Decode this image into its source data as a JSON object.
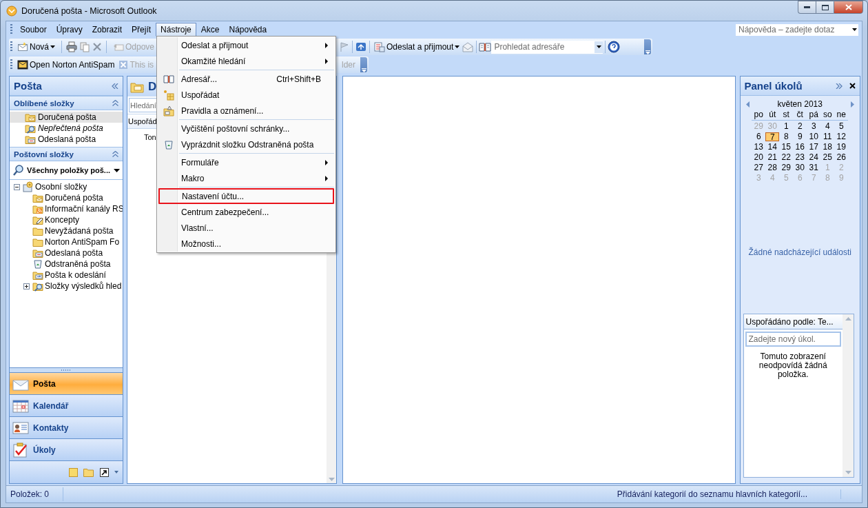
{
  "window": {
    "title": "Doručená pošta - Microsoft Outlook"
  },
  "menu_bar": [
    {
      "label": "Soubor",
      "selected": false
    },
    {
      "label": "Úpravy",
      "selected": false
    },
    {
      "label": "Zobrazit",
      "selected": false
    },
    {
      "label": "Přejít",
      "selected": false
    },
    {
      "label": "Nástroje",
      "selected": true
    },
    {
      "label": "Akce",
      "selected": false
    },
    {
      "label": "Nápověda",
      "selected": false
    }
  ],
  "help_search": {
    "placeholder": "Nápověda – zadejte dotaz"
  },
  "standard_toolbar": {
    "new_button": "Nová",
    "reply_button": {
      "label": "Odpove",
      "disabled": true
    },
    "send_receive_button": "Odeslat a přijmout",
    "address_search": {
      "placeholder": "Prohledat adresáře"
    }
  },
  "antispam_toolbar": {
    "open_button": "Open Norton AntiSpam",
    "button_2": {
      "label": "This is",
      "disabled": true
    },
    "button_3": {
      "label": "lder",
      "disabled": true
    }
  },
  "navigation_pane": {
    "title": "Pošta",
    "favorites": {
      "title": "Oblíbené složky",
      "items": [
        {
          "label": "Doručená pošta",
          "kind": "inbox",
          "selected": true,
          "italic": false
        },
        {
          "label": "Nepřečtená pošta",
          "kind": "search",
          "selected": false,
          "italic": true
        },
        {
          "label": "Odeslaná pošta",
          "kind": "sent",
          "selected": false,
          "italic": false
        }
      ]
    },
    "mail_folders": {
      "title": "Poštovní složky",
      "view": "Všechny položky poš...",
      "tree": [
        {
          "label": "Osobní složky",
          "kind": "store",
          "expanded": true,
          "children": [
            {
              "label": "Doručená pošta",
              "kind": "inbox"
            },
            {
              "label": "Informační kanály RS",
              "kind": "rss"
            },
            {
              "label": "Koncepty",
              "kind": "drafts"
            },
            {
              "label": "Nevyžádaná pošta",
              "kind": "folder"
            },
            {
              "label": "Norton AntiSpam Fo",
              "kind": "folder"
            },
            {
              "label": "Odeslaná pošta",
              "kind": "sent"
            },
            {
              "label": "Odstraněná pošta",
              "kind": "deleted"
            },
            {
              "label": "Pošta k odeslání",
              "kind": "outbox"
            },
            {
              "label": "Složky výsledků hled",
              "kind": "search",
              "expanded": false
            }
          ]
        }
      ]
    },
    "buttons": [
      {
        "label": "Pošta",
        "kind": "mail",
        "selected": true
      },
      {
        "label": "Kalendář",
        "kind": "calendar",
        "selected": false
      },
      {
        "label": "Kontakty",
        "kind": "contacts",
        "selected": false
      },
      {
        "label": "Úkoly",
        "kind": "tasks",
        "selected": false
      }
    ]
  },
  "message_list": {
    "header": "D",
    "search": {
      "placeholder": "Hledání"
    },
    "arrange_by": "Uspořád",
    "row_1": "Ton"
  },
  "tools_menu": {
    "groups": [
      [
        {
          "label": "Odeslat a přijmout",
          "kind": "plain",
          "submenu": true,
          "highlighted": false
        },
        {
          "label": "Okamžité hledání",
          "kind": "plain",
          "submenu": true,
          "highlighted": false
        }
      ],
      [
        {
          "label": "Adresář...",
          "kind": "book",
          "shortcut": "Ctrl+Shift+B",
          "submenu": false,
          "highlighted": false
        },
        {
          "label": "Uspořádat",
          "kind": "organize",
          "submenu": false,
          "highlighted": false
        },
        {
          "label": "Pravidla a oznámení...",
          "kind": "rules",
          "submenu": false,
          "highlighted": false
        }
      ],
      [
        {
          "label": "Vyčištění poštovní schránky...",
          "kind": "plain",
          "submenu": false,
          "highlighted": false
        },
        {
          "label": "Vyprázdnit složku Odstraněná pošta",
          "kind": "trash",
          "submenu": false,
          "highlighted": false
        }
      ],
      [
        {
          "label": "Formuláře",
          "kind": "plain",
          "submenu": true,
          "highlighted": false
        },
        {
          "label": "Makro",
          "kind": "plain",
          "submenu": true,
          "highlighted": false
        }
      ],
      [
        {
          "label": "Nastavení účtu...",
          "kind": "plain",
          "submenu": false,
          "highlighted": true
        },
        {
          "label": "Centrum zabezpečení...",
          "kind": "plain",
          "submenu": false,
          "highlighted": false
        },
        {
          "label": "Vlastní...",
          "kind": "plain",
          "submenu": false,
          "highlighted": false
        },
        {
          "label": "Možnosti...",
          "kind": "plain",
          "submenu": false,
          "highlighted": false
        }
      ]
    ]
  },
  "task_pane": {
    "title": "Panel úkolů",
    "calendar": {
      "month": "květen 2013",
      "weekdays": [
        "po",
        "út",
        "st",
        "čt",
        "pá",
        "so",
        "ne"
      ],
      "weeks": [
        [
          {
            "day": "29",
            "other_month": true,
            "selected": false
          },
          {
            "day": "30",
            "other_month": true,
            "selected": false
          },
          {
            "day": "1",
            "other_month": false,
            "selected": false
          },
          {
            "day": "2",
            "other_month": false,
            "selected": false
          },
          {
            "day": "3",
            "other_month": false,
            "selected": false
          },
          {
            "day": "4",
            "other_month": false,
            "selected": false
          },
          {
            "day": "5",
            "other_month": false,
            "selected": false
          }
        ],
        [
          {
            "day": "6",
            "other_month": false,
            "selected": false
          },
          {
            "day": "7",
            "other_month": false,
            "selected": true
          },
          {
            "day": "8",
            "other_month": false,
            "selected": false
          },
          {
            "day": "9",
            "other_month": false,
            "selected": false
          },
          {
            "day": "10",
            "other_month": false,
            "selected": false
          },
          {
            "day": "11",
            "other_month": false,
            "selected": false
          },
          {
            "day": "12",
            "other_month": false,
            "selected": false
          }
        ],
        [
          {
            "day": "13",
            "other_month": false,
            "selected": false
          },
          {
            "day": "14",
            "other_month": false,
            "selected": false
          },
          {
            "day": "15",
            "other_month": false,
            "selected": false
          },
          {
            "day": "16",
            "other_month": false,
            "selected": false
          },
          {
            "day": "17",
            "other_month": false,
            "selected": false
          },
          {
            "day": "18",
            "other_month": false,
            "selected": false
          },
          {
            "day": "19",
            "other_month": false,
            "selected": false
          }
        ],
        [
          {
            "day": "20",
            "other_month": false,
            "selected": false
          },
          {
            "day": "21",
            "other_month": false,
            "selected": false
          },
          {
            "day": "22",
            "other_month": false,
            "selected": false
          },
          {
            "day": "23",
            "other_month": false,
            "selected": false
          },
          {
            "day": "24",
            "other_month": false,
            "selected": false
          },
          {
            "day": "25",
            "other_month": false,
            "selected": false
          },
          {
            "day": "26",
            "other_month": false,
            "selected": false
          }
        ],
        [
          {
            "day": "27",
            "other_month": false,
            "selected": false
          },
          {
            "day": "28",
            "other_month": false,
            "selected": false
          },
          {
            "day": "29",
            "other_month": false,
            "selected": false
          },
          {
            "day": "30",
            "other_month": false,
            "selected": false
          },
          {
            "day": "31",
            "other_month": false,
            "selected": false
          },
          {
            "day": "1",
            "other_month": true,
            "selected": false
          },
          {
            "day": "2",
            "other_month": true,
            "selected": false
          }
        ],
        [
          {
            "day": "3",
            "other_month": true,
            "selected": false
          },
          {
            "day": "4",
            "other_month": true,
            "selected": false
          },
          {
            "day": "5",
            "other_month": true,
            "selected": false
          },
          {
            "day": "6",
            "other_month": true,
            "selected": false
          },
          {
            "day": "7",
            "other_month": true,
            "selected": false
          },
          {
            "day": "8",
            "other_month": true,
            "selected": false
          },
          {
            "day": "9",
            "other_month": true,
            "selected": false
          }
        ]
      ]
    },
    "events": "Žádné nadcházející události",
    "task_list": {
      "arrange_by": "Uspořádáno podle: Te...",
      "new_task": {
        "placeholder": "Zadejte nový úkol."
      },
      "empty_message": "Tomuto zobrazení neodpovídá žádná položka."
    }
  },
  "status_bar": {
    "items_count": "Položek: 0",
    "message": "Přidávání kategorií do seznamu hlavních kategorií..."
  }
}
